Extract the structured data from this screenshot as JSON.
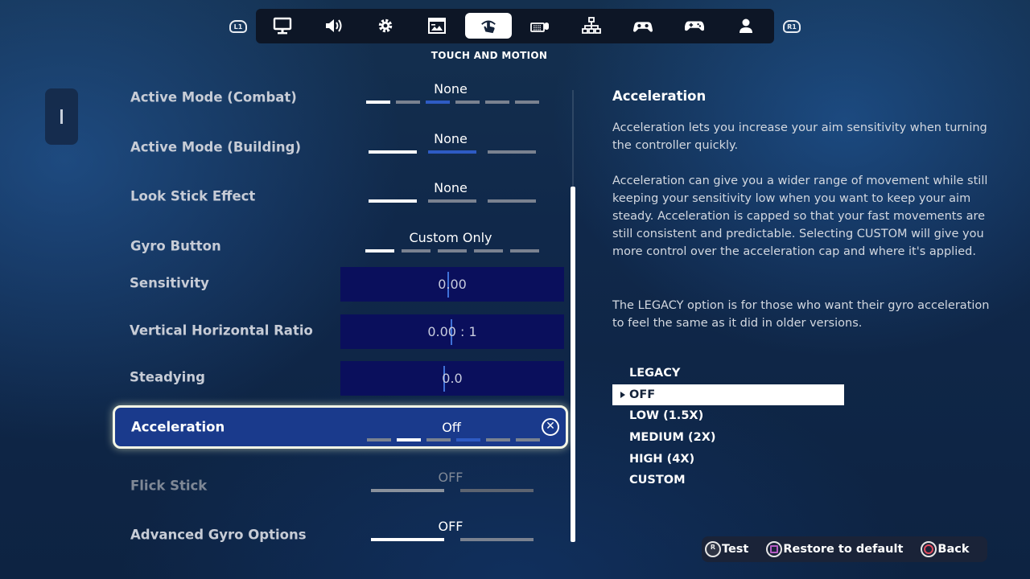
{
  "nav": {
    "left_bumper": "L1",
    "right_bumper": "R1",
    "tabs": [
      {
        "icon": "monitor-icon",
        "active": false
      },
      {
        "icon": "speaker-icon",
        "active": false
      },
      {
        "icon": "gear-icon",
        "active": false
      },
      {
        "icon": "hud-icon",
        "active": false
      },
      {
        "icon": "touch-motion-icon",
        "active": true
      },
      {
        "icon": "keyboard-mouse-icon",
        "active": false
      },
      {
        "icon": "network-icon",
        "active": false
      },
      {
        "icon": "controller-gear-icon",
        "active": false
      },
      {
        "icon": "gamepad-icon",
        "active": false
      },
      {
        "icon": "account-icon",
        "active": false
      }
    ],
    "section_title": "TOUCH AND MOTION"
  },
  "settings": {
    "active_mode_combat": {
      "label": "Active Mode (Combat)",
      "value": "None",
      "option_count": 6,
      "selected_index": 0
    },
    "active_mode_building": {
      "label": "Active Mode (Building)",
      "value": "None",
      "option_count": 3,
      "selected_index": 0
    },
    "look_stick_effect": {
      "label": "Look Stick Effect",
      "value": "None",
      "option_count": 3,
      "selected_index": 0
    },
    "gyro_button": {
      "label": "Gyro Button",
      "value": "Custom Only",
      "option_count": 5,
      "selected_index": 0
    },
    "sensitivity": {
      "label": "Sensitivity",
      "value": "0.00"
    },
    "vertical_horizontal_ratio": {
      "label": "Vertical Horizontal Ratio",
      "value": "0.00 : 1"
    },
    "steadying": {
      "label": "Steadying",
      "value": "0.0"
    },
    "acceleration": {
      "label": "Acceleration",
      "value": "Off",
      "option_count": 6,
      "selected_index": 1
    },
    "flick_stick": {
      "label": "Flick Stick",
      "value": "OFF",
      "option_count": 2,
      "selected_index": 0
    },
    "advanced_gyro_options": {
      "label": "Advanced Gyro Options",
      "value": "OFF",
      "option_count": 2,
      "selected_index": 0
    }
  },
  "description": {
    "title": "Acceleration",
    "paragraph1": "Acceleration lets you increase your aim sensitivity when turning the controller quickly.",
    "paragraph2": "Acceleration can give you a wider range of movement while still keeping your sensitivity low when you want to keep your aim steady. Acceleration is capped so that your fast movements are still consistent and predictable. Selecting CUSTOM will give you more control over the acceleration cap and where it's applied.",
    "paragraph3": "The LEGACY option is for those who want their gyro acceleration to feel the same as it did in older versions.",
    "options": [
      "LEGACY",
      "OFF",
      "LOW (1.5X)",
      "MEDIUM (2X)",
      "HIGH (4X)",
      "CUSTOM"
    ],
    "selected_option": "OFF"
  },
  "footer": {
    "test_glyph": "R",
    "test_label": "Test",
    "restore_label": "Restore to default",
    "back_label": "Back"
  },
  "colors": {
    "accent": "#2e5bc4",
    "selected_row": "#1a3a8c",
    "slider_bg": "#0a0f5c"
  }
}
